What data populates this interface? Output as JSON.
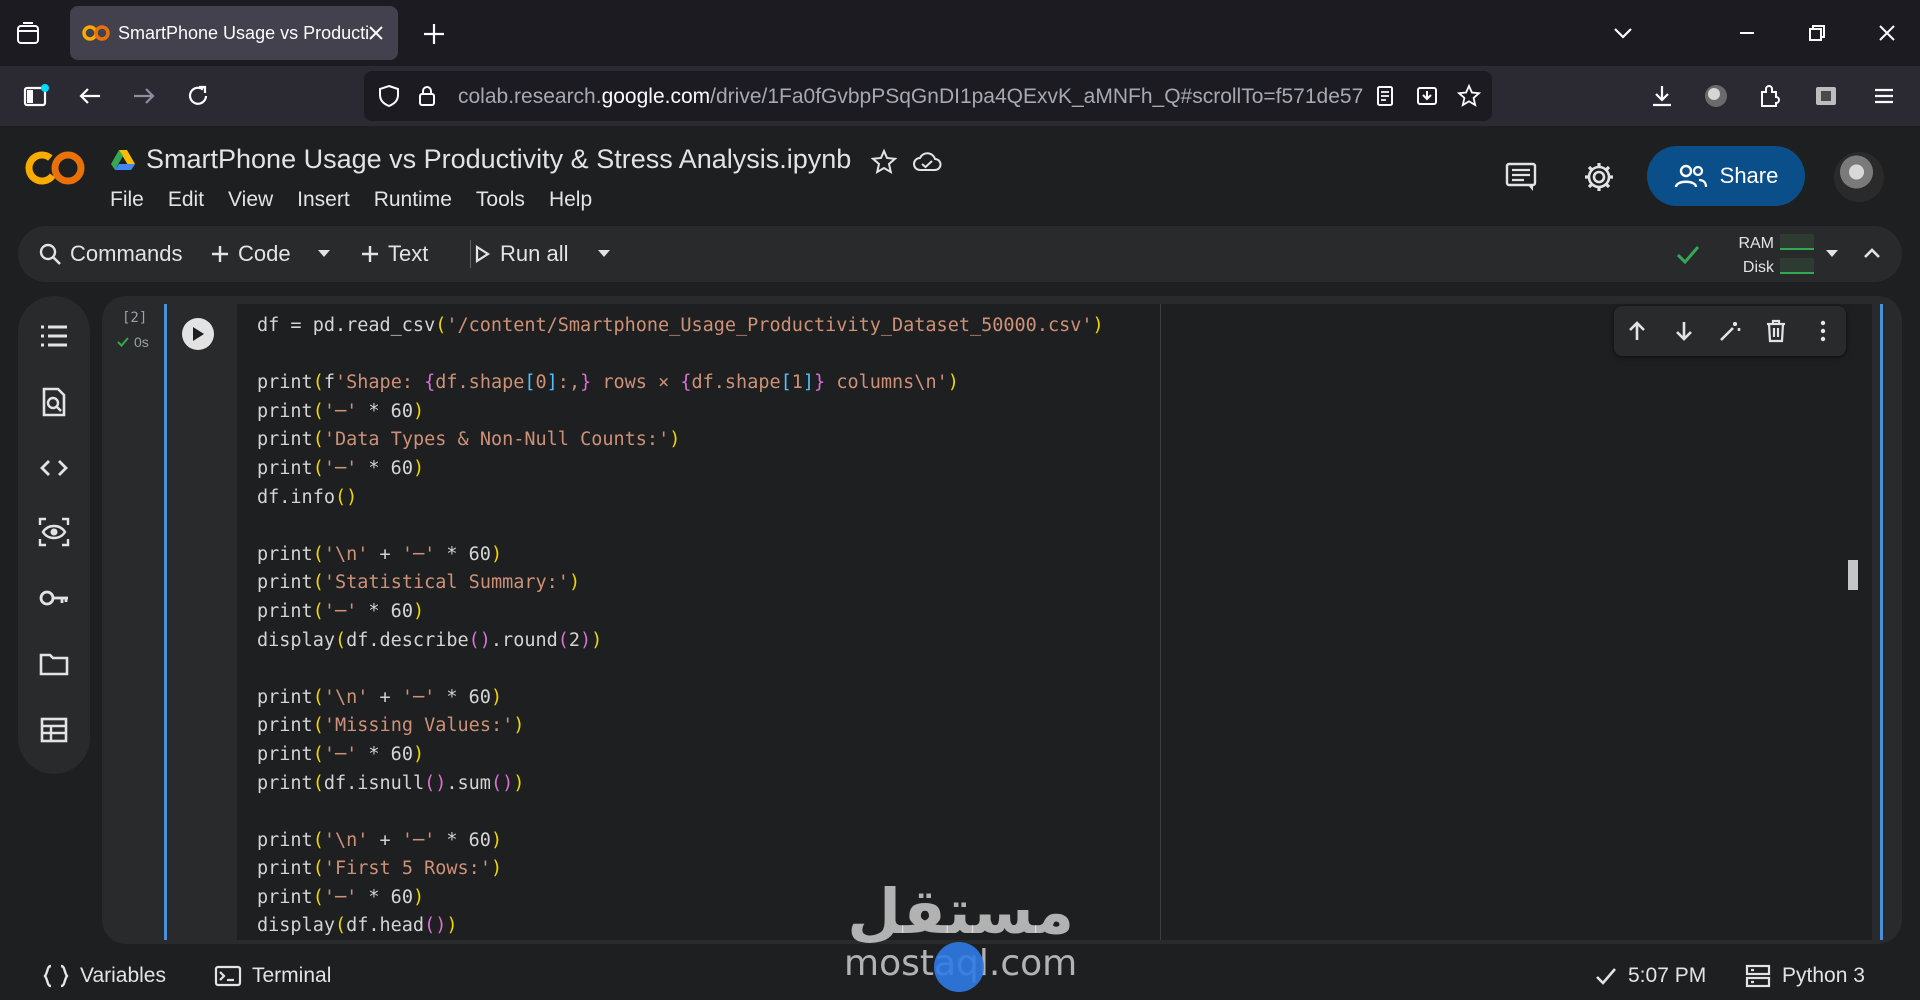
{
  "browser": {
    "tab_title": "SmartPhone Usage vs Productiv",
    "url_prefix": "colab.research.",
    "url_host": "google.com",
    "url_path": "/drive/1Fa0fGvbpPSqGnDI1pa4QExvK_aMNFh_Q#scrollTo=f571de57"
  },
  "colab": {
    "notebook_title": "SmartPhone Usage vs Productivity & Stress Analysis.ipynb",
    "menu": [
      "File",
      "Edit",
      "View",
      "Insert",
      "Runtime",
      "Tools",
      "Help"
    ],
    "share_label": "Share"
  },
  "toolbar": {
    "commands_label": "Commands",
    "code_label": "Code",
    "text_label": "Text",
    "run_all_label": "Run all",
    "ram_label": "RAM",
    "disk_label": "Disk"
  },
  "cell": {
    "execution_count": "[2]",
    "execution_time": "0s",
    "code_lines": [
      "df = pd.read_csv('/content/Smartphone_Usage_Productivity_Dataset_50000.csv')",
      "",
      "print(f'Shape: {df.shape[0]:,} rows × {df.shape[1]} columns\\n')",
      "print('─' * 60)",
      "print('Data Types & Non-Null Counts:')",
      "print('─' * 60)",
      "df.info()",
      "",
      "print('\\n' + '─' * 60)",
      "print('Statistical Summary:')",
      "print('─' * 60)",
      "display(df.describe().round(2))",
      "",
      "print('\\n' + '─' * 60)",
      "print('Missing Values:')",
      "print('─' * 60)",
      "print(df.isnull().sum())",
      "",
      "print('\\n' + '─' * 60)",
      "print('First 5 Rows:')",
      "print('─' * 60)",
      "display(df.head())"
    ]
  },
  "statusbar": {
    "variables_label": "Variables",
    "terminal_label": "Terminal",
    "time": "5:07 PM",
    "runtime": "Python 3"
  },
  "watermark": {
    "arabic": "مستقل",
    "latin": "mostaql.com"
  },
  "colors": {
    "accent_blue": "#0b4f8a",
    "cell_border": "#4a90d9",
    "string": "#ce9178",
    "bracket_gold": "#f1d700",
    "bracket_purple": "#da70d6",
    "bracket_blue": "#4fc1ff",
    "success_green": "#34a853",
    "colab_orange": "#f9ab00"
  }
}
